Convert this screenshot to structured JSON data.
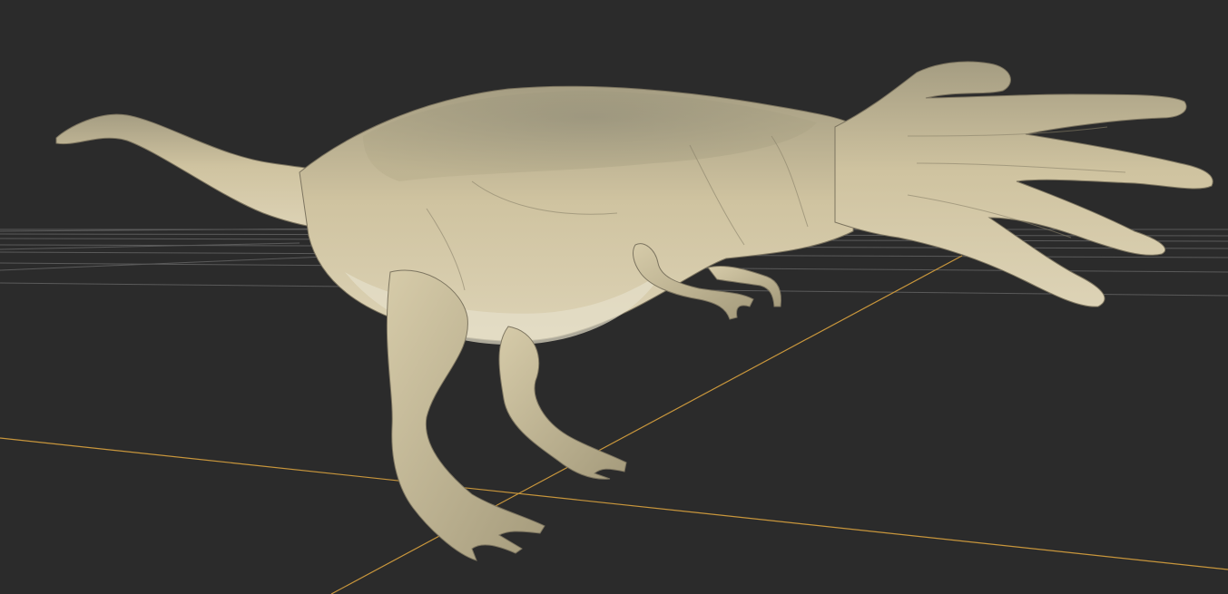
{
  "viewport": {
    "background_color": "#2b2b2b",
    "grid_color": "#7a7a7a",
    "axis_x_color": "#c8963c",
    "axis_z_color": "#c8963c",
    "model_color": "#cfc3a0",
    "model_shadow_color": "#8d8468",
    "model_name": "",
    "icon": "viewport-3d-icon"
  }
}
